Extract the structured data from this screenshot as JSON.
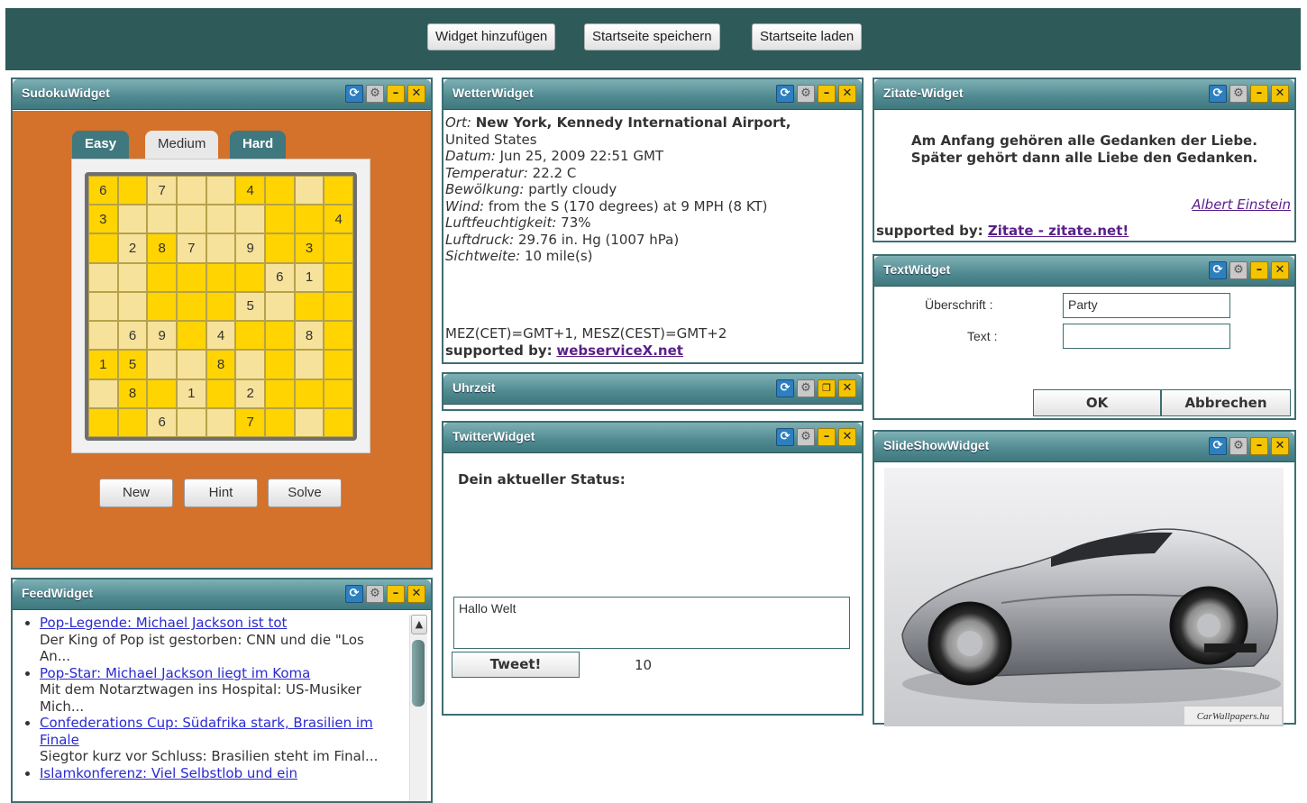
{
  "toolbar": {
    "add_widget": "Widget hinzufügen",
    "save_home": "Startseite speichern",
    "load_home": "Startseite laden"
  },
  "sudoku": {
    "title": "SudokuWidget",
    "tabs": [
      "Easy",
      "Medium",
      "Hard"
    ],
    "active_tab": "Medium",
    "grid": [
      [
        "6",
        "",
        "7",
        "",
        "",
        "4",
        "",
        "",
        ""
      ],
      [
        "3",
        "",
        "",
        "",
        "",
        "",
        "",
        "",
        "4"
      ],
      [
        "",
        "2",
        "8",
        "7",
        "",
        "9",
        "",
        "3",
        ""
      ],
      [
        "",
        "",
        "",
        "",
        "",
        "",
        "6",
        "1",
        ""
      ],
      [
        "",
        "",
        "",
        "",
        "",
        "5",
        "",
        "",
        ""
      ],
      [
        "",
        "6",
        "9",
        "",
        "4",
        "",
        "",
        "8",
        ""
      ],
      [
        "1",
        "5",
        "",
        "",
        "8",
        "",
        "",
        "",
        ""
      ],
      [
        "",
        "8",
        "",
        "1",
        "",
        "2",
        "",
        "",
        ""
      ],
      [
        "",
        "",
        "6",
        "",
        "",
        "7",
        "",
        "",
        ""
      ]
    ],
    "buttons": {
      "new": "New",
      "hint": "Hint",
      "solve": "Solve"
    }
  },
  "feed": {
    "title": "FeedWidget",
    "items": [
      {
        "link": "Pop-Legende: Michael Jackson ist tot",
        "text": "Der King of Pop ist gestorben: CNN und die \"Los An..."
      },
      {
        "link": "Pop-Star: Michael Jackson liegt im Koma",
        "text": "Mit dem Notarztwagen ins Hospital: US-Musiker Mich..."
      },
      {
        "link": "Confederations Cup: Südafrika stark, Brasilien im Finale",
        "text": "Siegtor kurz vor Schluss: Brasilien steht im Final..."
      },
      {
        "link": "Islamkonferenz: Viel Selbstlob und ein",
        "text": ""
      }
    ]
  },
  "weather": {
    "title": "WetterWidget",
    "ort_label": "Ort:",
    "ort_value": "New York, Kennedy International Airport,",
    "ort_country": "United States",
    "datum_label": "Datum:",
    "datum_value": "Jun 25, 2009 22:51 GMT",
    "temp_label": "Temperatur:",
    "temp_value": "22.2 C",
    "cloud_label": "Bewölkung:",
    "cloud_value": "partly cloudy",
    "wind_label": "Wind:",
    "wind_value": "from the S (170 degrees) at 9 MPH (8 KT)",
    "humidity_label": "Luftfeuchtigkeit:",
    "humidity_value": "73%",
    "pressure_label": "Luftdruck:",
    "pressure_value": "29.76 in. Hg (1007 hPa)",
    "visibility_label": "Sichtweite:",
    "visibility_value": "10 mile(s)",
    "timezone_note": "MEZ(CET)=GMT+1, MESZ(CEST)=GMT+2",
    "supported_label": "supported by:",
    "supported_link": "webserviceX.net"
  },
  "clock": {
    "title": "Uhrzeit"
  },
  "twitter": {
    "title": "TwitterWidget",
    "status_label": "Dein aktueller Status:",
    "input_value": "Hallo Welt",
    "tweet_button": "Tweet!",
    "char_count": "10"
  },
  "quote": {
    "title": "Zitate-Widget",
    "text_line1": "Am Anfang gehören alle Gedanken der Liebe.",
    "text_line2": "Später gehört dann alle Liebe den Gedanken.",
    "author": "Albert Einstein",
    "supported_label": "supported by:",
    "supported_link": "Zitate - zitate.net!"
  },
  "textwidget": {
    "title": "TextWidget",
    "heading_label": "Überschrift :",
    "heading_value": "Party",
    "text_label": "Text :",
    "text_value": "",
    "ok": "OK",
    "cancel": "Abbrechen"
  },
  "slideshow": {
    "title": "SlideShowWidget",
    "watermark": "CarWallpapers.hu"
  },
  "colors": {
    "topbar": "#2f5a5a",
    "header": "#4f8a90",
    "sudoku_bg": "#d4712a",
    "cell_yellow": "#ffd400",
    "cell_light": "#f6e29a"
  }
}
